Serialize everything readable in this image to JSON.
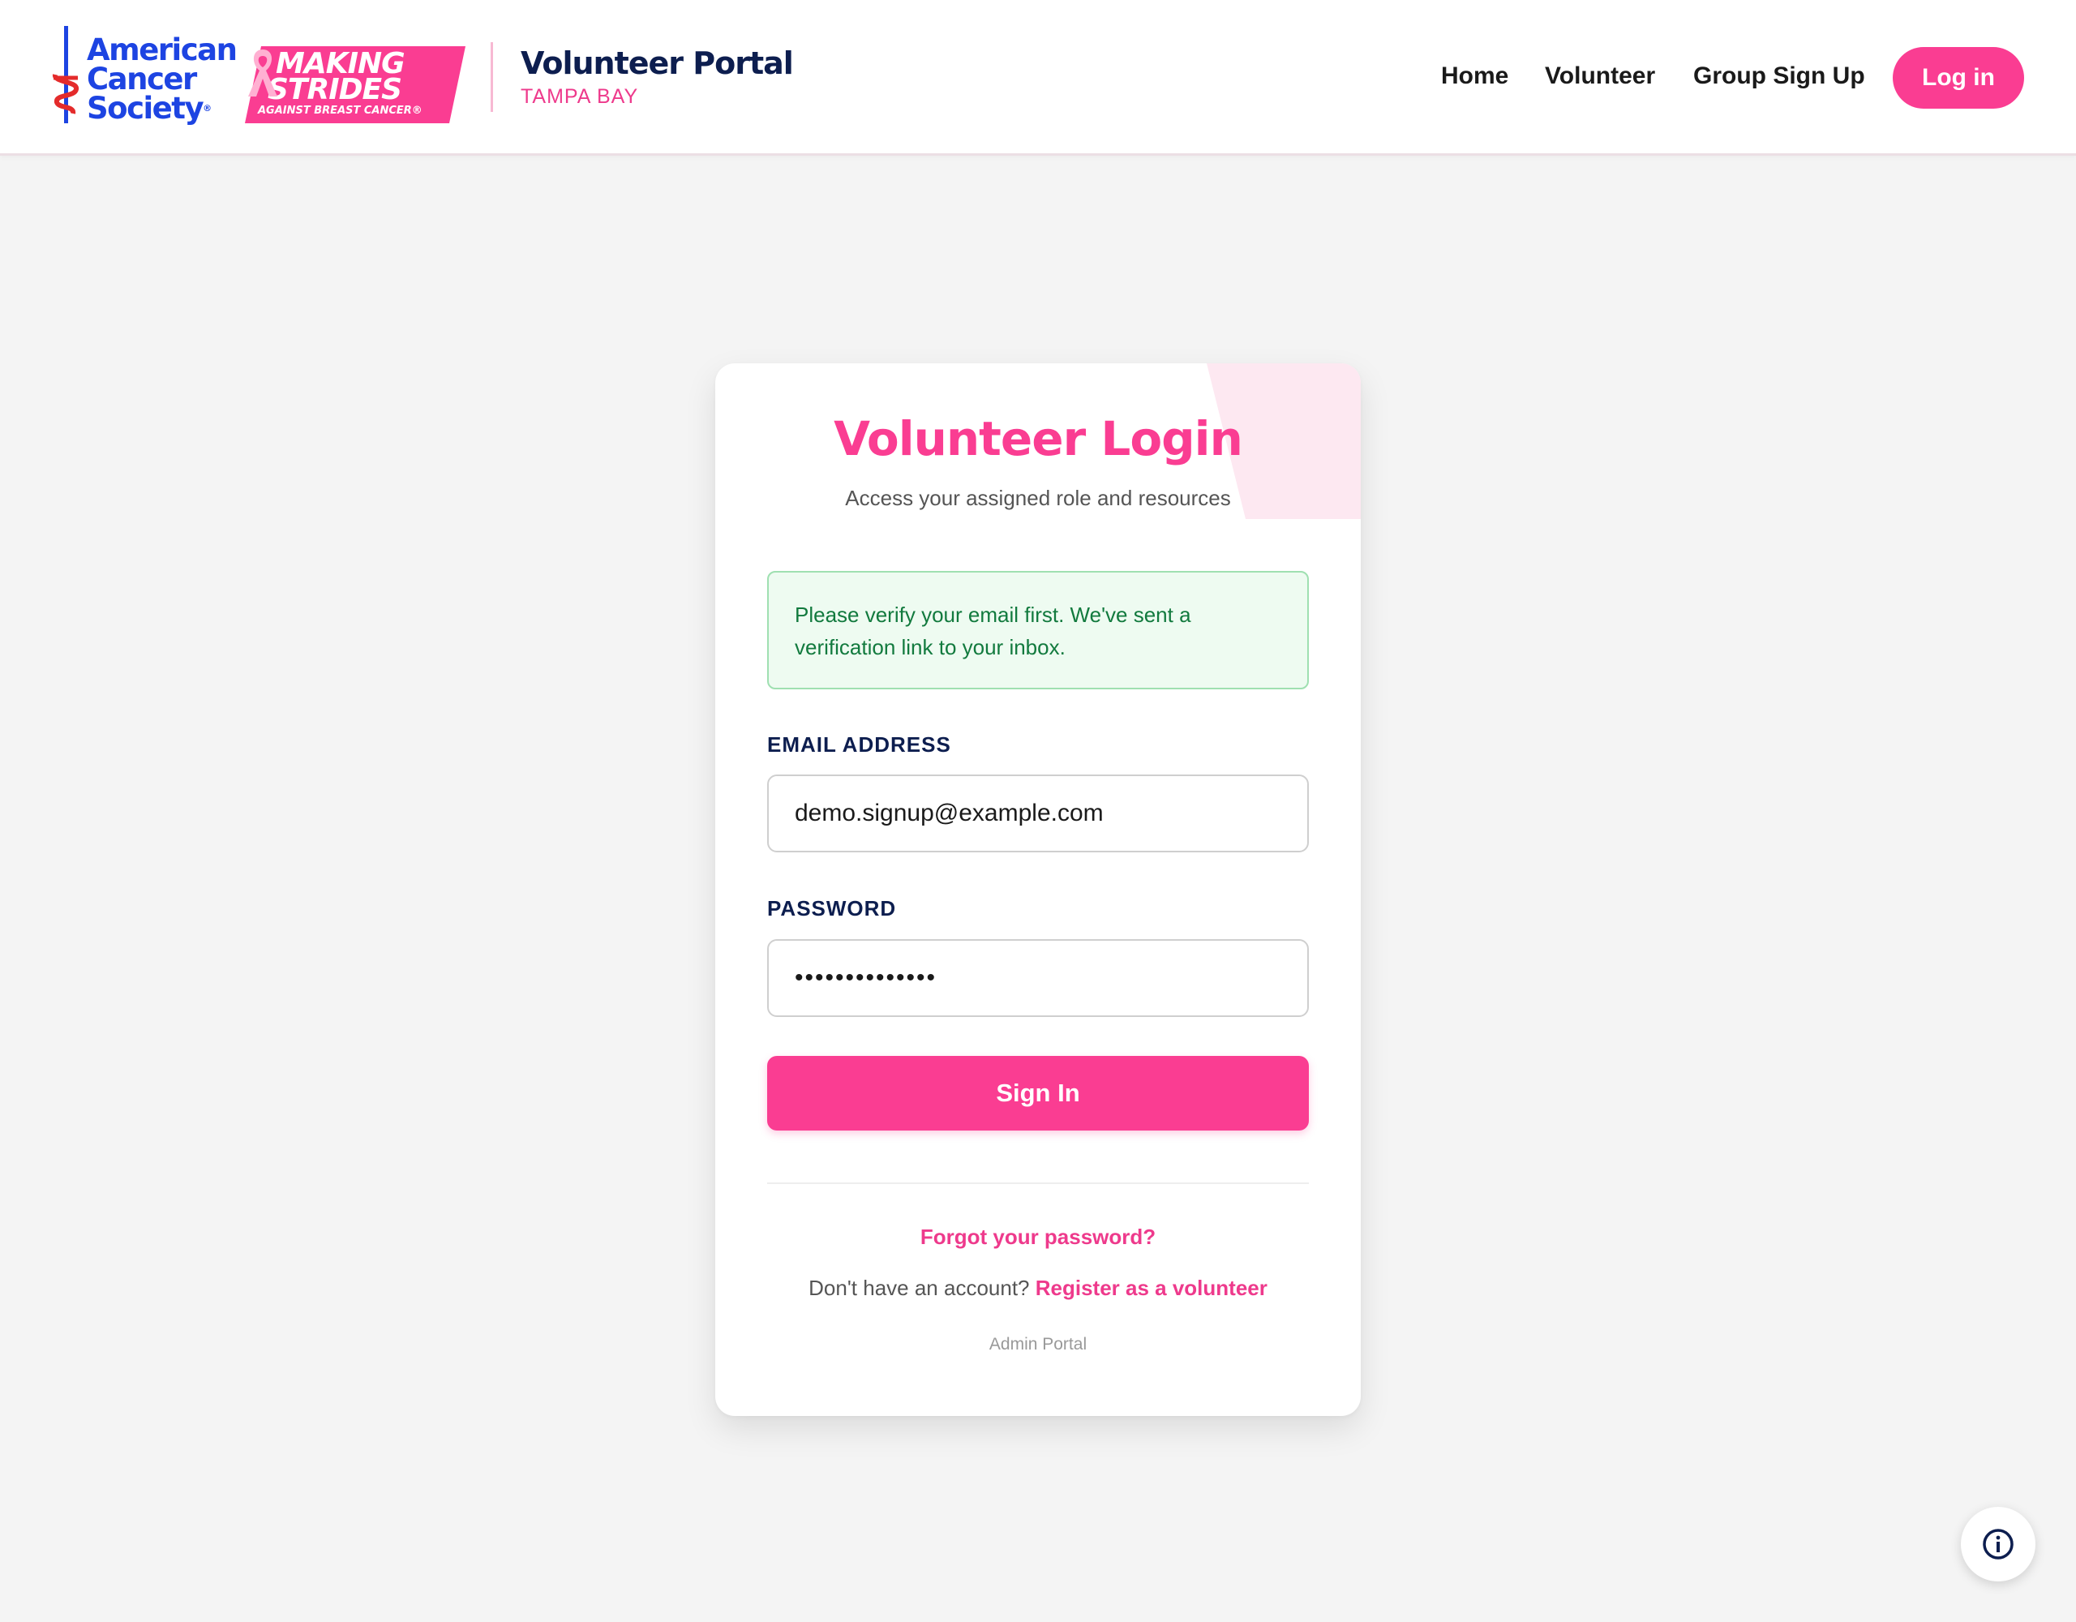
{
  "header": {
    "acs_logo": {
      "line1": "American",
      "line2": "Cancer",
      "line3": "Society",
      "mark": "®"
    },
    "making_strides": {
      "line1": "MAKING",
      "line2": "STRIDES",
      "line3": "AGAINST BREAST CANCER®"
    },
    "portal_title": "Volunteer Portal",
    "portal_subtitle": "TAMPA BAY",
    "nav": {
      "home": "Home",
      "volunteer": "Volunteer",
      "group_signup": "Group Sign Up"
    },
    "login_button": "Log in"
  },
  "login_card": {
    "title": "Volunteer Login",
    "subtitle": "Access your assigned role and resources",
    "alert_message": "Please verify your email first. We've sent a verification link to your inbox.",
    "email_label": "EMAIL ADDRESS",
    "email_value": "demo.signup@example.com",
    "password_label": "PASSWORD",
    "password_value": "••••••••••••••",
    "signin_button": "Sign In",
    "forgot_password": "Forgot your password?",
    "no_account_text": "Don't have an account?",
    "register_link": "Register as a volunteer",
    "admin_portal": "Admin Portal"
  },
  "icons": {
    "info": "info-icon",
    "ribbon": "pink-ribbon-icon",
    "acs_sword": "acs-sword-icon"
  },
  "colors": {
    "brand_pink": "#fa3d92",
    "navy": "#0d1e4f",
    "acs_blue": "#1d44e2",
    "success_green": "#127a3e"
  }
}
